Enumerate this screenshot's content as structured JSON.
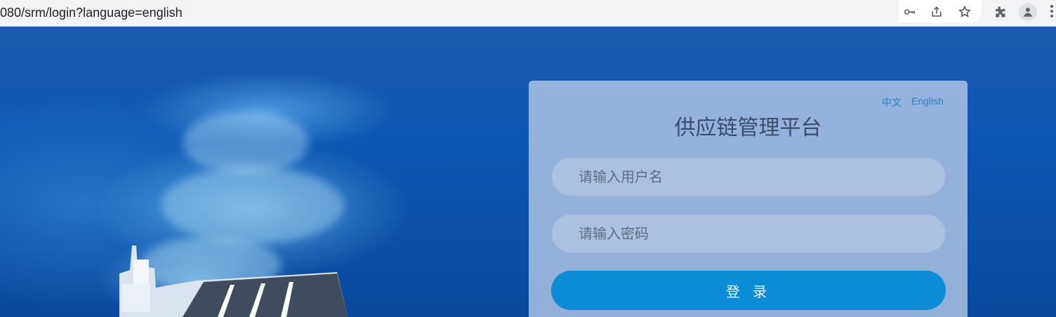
{
  "browser": {
    "url": "080/srm/login?language=english",
    "icons": [
      "key-icon",
      "share-icon",
      "star-icon",
      "extension-icon",
      "profile-icon",
      "menu-icon"
    ]
  },
  "login": {
    "lang_zh": "中文",
    "lang_en": "English",
    "title": "供应链管理平台",
    "username_placeholder": "请输入用户名",
    "password_placeholder": "请输入密码",
    "login_label": "登 录"
  },
  "colors": {
    "accent": "#0a8cd6",
    "link": "#2a7fc8",
    "title": "#3b4c6b"
  }
}
